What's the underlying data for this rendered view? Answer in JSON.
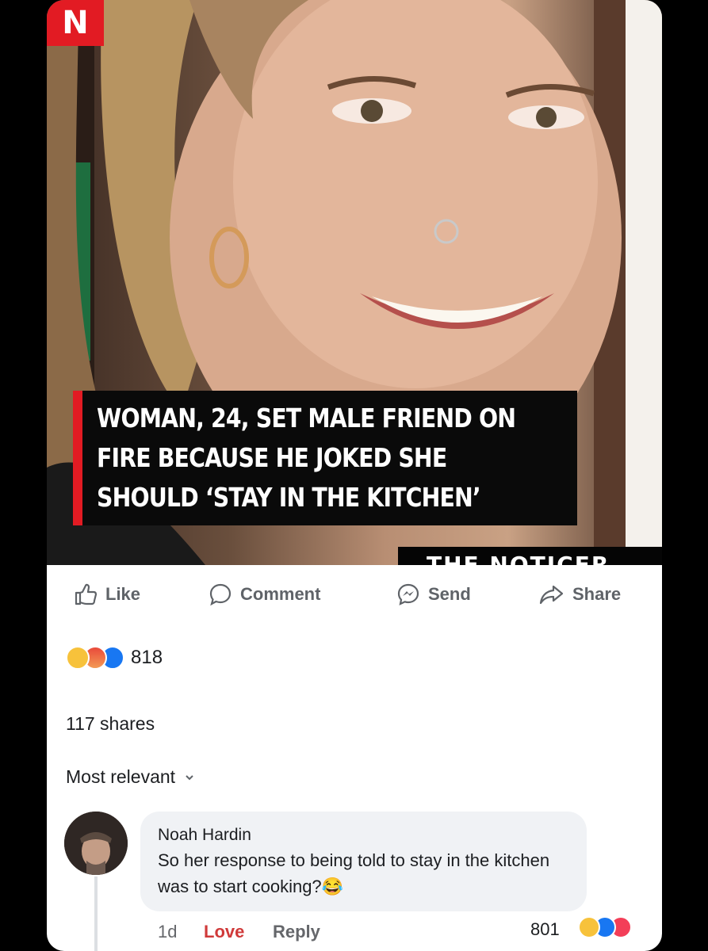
{
  "post": {
    "brand_badge": "N",
    "headline": "WOMAN, 24, SET MALE FRIEND ON\nFIRE BECAUSE HE JOKED SHE\nSHOULD ‘STAY IN THE KITCHEN’",
    "watermark": "THE NOTICER"
  },
  "actions": {
    "like": "Like",
    "comment": "Comment",
    "send": "Send",
    "share": "Share"
  },
  "reactions": {
    "count": "818",
    "icons": [
      "haha-icon",
      "angry-icon",
      "like-icon"
    ]
  },
  "shares": "117 shares",
  "sort": {
    "label": "Most relevant"
  },
  "comment": {
    "author": "Noah Hardin",
    "text": "So her response to being told to stay in the kitchen was to start cooking?",
    "emoji": "😂",
    "time": "1d",
    "love": "Love",
    "reply": "Reply",
    "reaction_count": "801",
    "reaction_icons": [
      "haha-icon",
      "like-icon",
      "love-icon"
    ]
  },
  "colors": {
    "brand_red": "#e21b23",
    "facebook_blue": "#1877f2",
    "love_red": "#d03a3a"
  }
}
